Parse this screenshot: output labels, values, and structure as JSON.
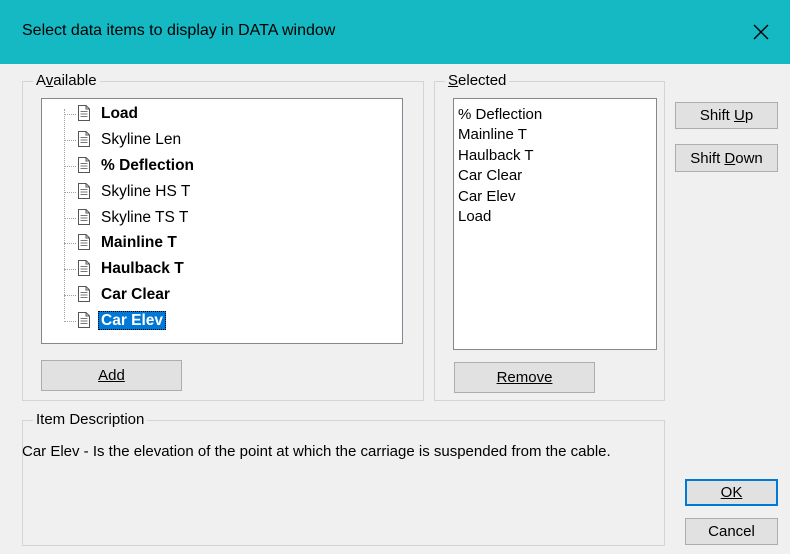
{
  "window": {
    "title": "Select data items to display in DATA window",
    "close_icon": "close-icon"
  },
  "available": {
    "legend": "Available",
    "items": [
      {
        "label": "Load",
        "bold": true,
        "selected": false
      },
      {
        "label": "Skyline Len",
        "bold": false,
        "selected": false
      },
      {
        "label": "% Deflection",
        "bold": true,
        "selected": false
      },
      {
        "label": "Skyline HS T",
        "bold": false,
        "selected": false
      },
      {
        "label": "Skyline TS T",
        "bold": false,
        "selected": false
      },
      {
        "label": "Mainline T",
        "bold": true,
        "selected": false
      },
      {
        "label": "Haulback T",
        "bold": true,
        "selected": false
      },
      {
        "label": "Car Clear",
        "bold": true,
        "selected": false
      },
      {
        "label": "Car Elev",
        "bold": true,
        "selected": true
      }
    ],
    "add_button": "Add"
  },
  "selected": {
    "legend": "Selected",
    "items": [
      "% Deflection",
      "Mainline T",
      "Haulback T",
      "Car Clear",
      "Car Elev",
      "Load"
    ],
    "remove_button": "Remove"
  },
  "buttons": {
    "shift_up": "Shift Up",
    "shift_down": "Shift Down",
    "ok": "OK",
    "cancel": "Cancel"
  },
  "description": {
    "legend": "Item Description",
    "text": "Car Elev - Is the elevation of the point at which the carriage is suspended from the cable."
  },
  "colors": {
    "titlebar": "#15b9c4",
    "selection": "#0078d7",
    "dialog_bg": "#f0f0f0"
  }
}
